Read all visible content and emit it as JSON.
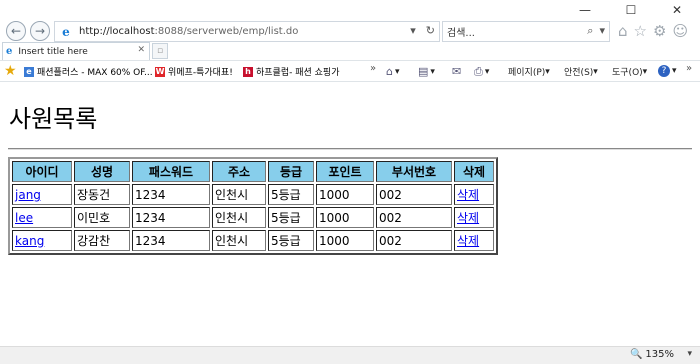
{
  "window": {
    "minimize": "—",
    "maximize": "☐",
    "close": "✕"
  },
  "nav": {
    "back": "←",
    "forward": "→"
  },
  "address": {
    "url_host": "http://localhost",
    "url_rest": ":8088/serverweb/emp/list.do",
    "dropdown": "▾",
    "refresh": "↻"
  },
  "search": {
    "text": "검색...",
    "icon": "⌕",
    "dropdown": "▾"
  },
  "toolbar_icons": {
    "home": "⌂",
    "favorites": "☆",
    "settings": "⚙",
    "smiley": "☺"
  },
  "tab": {
    "title": "Insert title here",
    "close": "✕"
  },
  "favorites": {
    "items": [
      {
        "label": "패션플러스 - MAX 60% OF...",
        "icon_color": "#3a7bd5",
        "icon": "e"
      },
      {
        "label": "위메프-특가대표!",
        "icon_color": "#e0262a",
        "icon": "W"
      },
      {
        "label": "하프클럽- 패션 쇼핑가",
        "icon_color": "#c8102e",
        "icon": "h"
      }
    ],
    "more": "»"
  },
  "commands": {
    "more": "»",
    "page": "페이지(P)",
    "safety": "안전(S)",
    "tools": "도구(O)",
    "help": "?"
  },
  "content": {
    "title": "사원목록",
    "table": {
      "headers": [
        "아이디",
        "성명",
        "패스워드",
        "주소",
        "등급",
        "포인트",
        "부서번호",
        "삭제"
      ],
      "rows": [
        {
          "id": "jang",
          "name": "장동건",
          "password": "1234",
          "address": "인천시",
          "grade": "5등급",
          "point": "1000",
          "dept": "002",
          "delete": "삭제"
        },
        {
          "id": "lee",
          "name": "이민호",
          "password": "1234",
          "address": "인천시",
          "grade": "5등급",
          "point": "1000",
          "dept": "002",
          "delete": "삭제"
        },
        {
          "id": "kang",
          "name": "강감찬",
          "password": "1234",
          "address": "인천시",
          "grade": "5등급",
          "point": "1000",
          "dept": "002",
          "delete": "삭제"
        }
      ]
    }
  },
  "status": {
    "zoom": "135%",
    "zoom_icon": "🔍",
    "dropdown": "▾"
  },
  "colors": {
    "header_bg": "#87CEEB",
    "link": "#0000EE"
  }
}
